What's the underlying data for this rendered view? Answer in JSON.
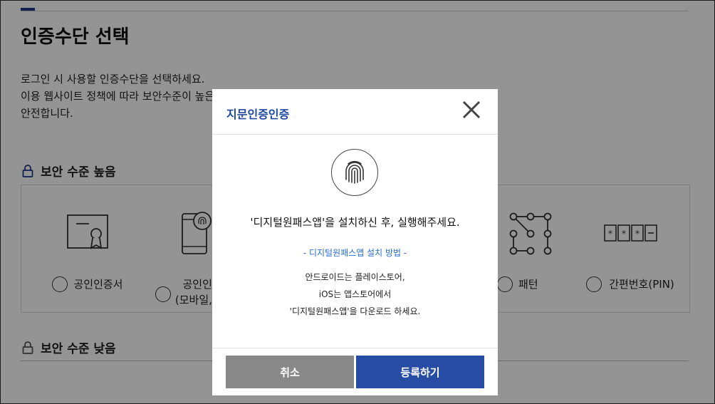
{
  "page": {
    "title": "인증수단 선택",
    "description": [
      "로그인 시 사용할 인증수단을 선택하세요.",
      "이용 웹사이트 정책에 따라 보안수준이 높은 인증수단을 선택하시면 사이트 이용이 편리하고",
      "안전합니다."
    ]
  },
  "sections": {
    "high": "보안 수준 높음",
    "low": "보안 수준 낮음"
  },
  "methods": [
    {
      "label": "공인인증서",
      "icon": "certificate-icon"
    },
    {
      "label": "공인인증서\n(모바일, 지문)",
      "icon": "mobile-fingerprint-icon"
    },
    {
      "label": "패턴",
      "icon": "pattern-icon"
    },
    {
      "label": "간편번호(PIN)",
      "icon": "pin-icon"
    }
  ],
  "modal": {
    "title": "지문인증인증",
    "message": "'디지털원패스앱'을 설치하신 후, 실행해주세요.",
    "install_link": "- 디지털원패스앱 설치 방법 -",
    "install_lines": [
      "안드로이드는 플레이스토어,",
      "iOS는 앱스토어에서",
      "'디지털원패스앱'을 다운로드 하세요."
    ],
    "cancel_label": "취소",
    "register_label": "등록하기"
  },
  "colors": {
    "accent": "#274ca3",
    "title_blue": "#1f4aa0",
    "link_blue": "#2a6fd6",
    "cancel_gray": "#888888"
  }
}
